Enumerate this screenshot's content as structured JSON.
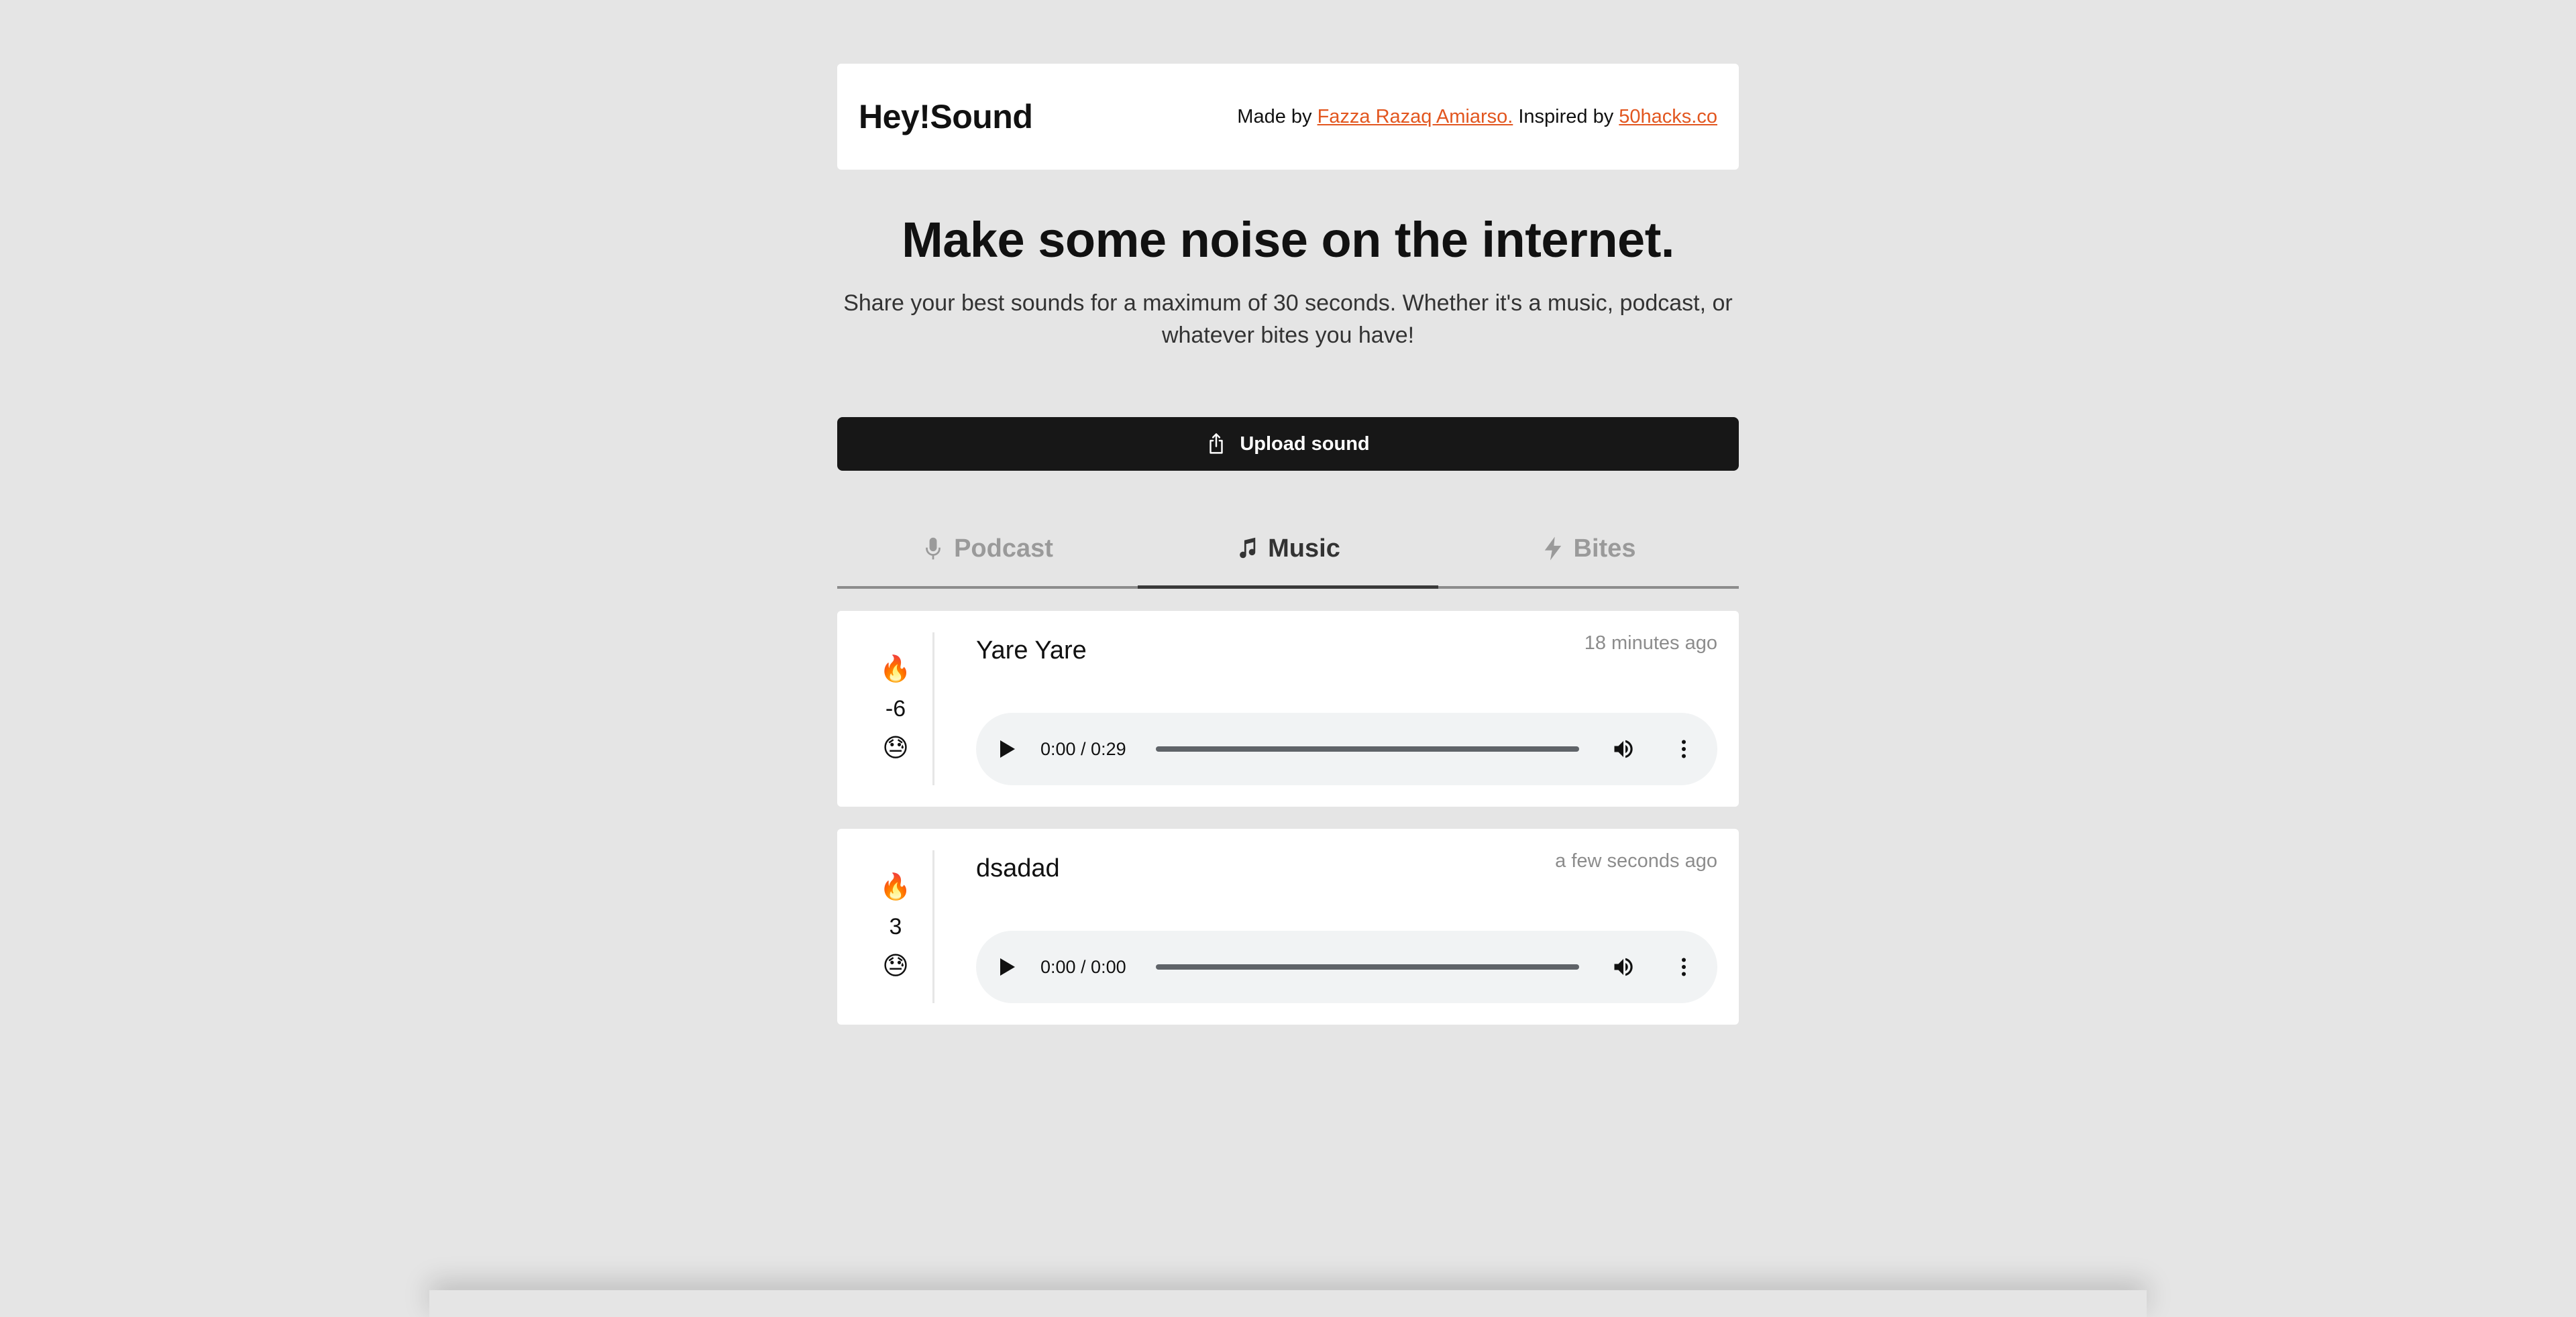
{
  "header": {
    "logo": "Hey!Sound",
    "made_by_prefix": "Made by ",
    "author": "Fazza Razaq Amiarso.",
    "inspired_prefix": " Inspired by ",
    "inspired_link": "50hacks.co"
  },
  "hero": {
    "title": "Make some noise on the internet.",
    "subtitle": "Share your best sounds for a maximum of 30 seconds. Whether it's a music, podcast, or whatever bites you have!"
  },
  "upload": {
    "label": "Upload sound",
    "icon": "share-icon"
  },
  "tabs": [
    {
      "label": "Podcast",
      "icon": "microphone-icon",
      "active": false
    },
    {
      "label": "Music",
      "icon": "music-note-icon",
      "active": true
    },
    {
      "label": "Bites",
      "icon": "lightning-icon",
      "active": false
    }
  ],
  "sounds": [
    {
      "upvote_icon": "🔥",
      "score": "-6",
      "downvote_icon": "😓",
      "title": "Yare Yare",
      "time": "18 minutes ago",
      "player_time": "0:00 / 0:29"
    },
    {
      "upvote_icon": "🔥",
      "score": "3",
      "downvote_icon": "😓",
      "title": "dsadad",
      "time": "a few seconds ago",
      "player_time": "0:00 / 0:00"
    }
  ],
  "colors": {
    "background": "#e5e5e5",
    "accent_link": "#e2561f",
    "button": "#171717"
  }
}
